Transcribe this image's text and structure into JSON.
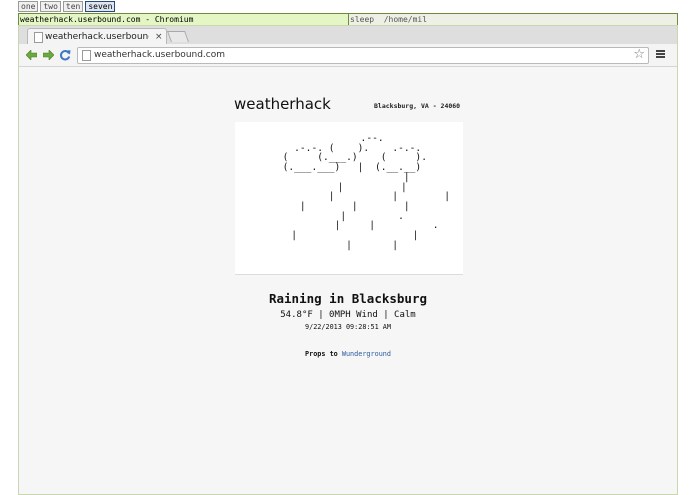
{
  "wm": {
    "tags": [
      "one",
      "two",
      "ten",
      "seven"
    ],
    "active_tag": "seven",
    "window_title": "weatherhack.userbound.com - Chromium",
    "status_text": "sleep  /home/mil"
  },
  "browser": {
    "tab": {
      "title": "weatherhack.userbound.com",
      "close_glyph": "×"
    },
    "address": "weatherhack.userbound.com",
    "icons": {
      "back": "back-arrow-icon",
      "forward": "forward-arrow-icon",
      "reload": "reload-icon",
      "page": "page-icon",
      "bookmark": "star-icon",
      "menu": "hamburger-menu-icon"
    },
    "colors": {
      "nav_arrows": "#6aa840",
      "reload": "#3a78c6",
      "link": "#2b5ca0"
    }
  },
  "page": {
    "site_title": "weatherhack",
    "location": "Blacksburg, VA - 24060",
    "ascii_art": "        .--.\n   .-.-. (    ).    .-.-.\n  (     (.___.)    (     ).\n (.___.___)   |  (.__.__)\n                    |\n        |          |\n              |          |        |\n  |        |        |\n        |         .\n             |     |          .\n  |                    |\n        |       |",
    "condition": "Raining in Blacksburg",
    "readings": "54.8°F | 0MPH Wind | Calm",
    "timestamp": "9/22/2013 09:28:51 AM",
    "credits_label": "Props to",
    "credits_link": "Wunderground"
  }
}
